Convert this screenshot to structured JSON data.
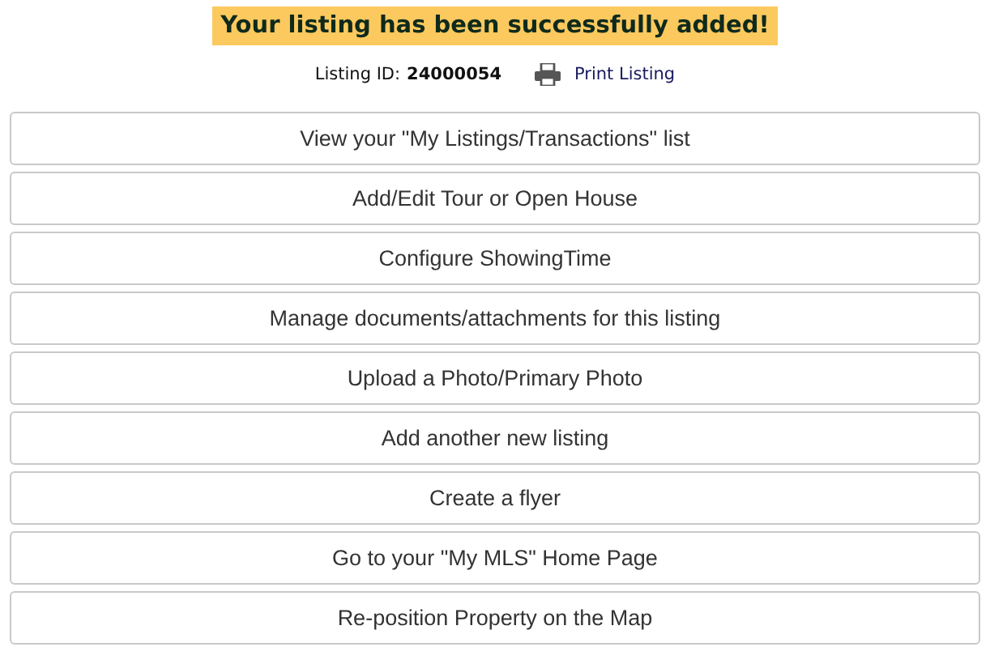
{
  "banner": "Your listing has been successfully added!",
  "listing_id": {
    "label": "Listing ID:",
    "value": "24000054"
  },
  "print_link": "Print Listing",
  "actions": [
    "View your \"My Listings/Transactions\" list",
    "Add/Edit Tour or Open House",
    "Configure ShowingTime",
    "Manage documents/attachments for this listing",
    "Upload a Photo/Primary Photo",
    "Add another new listing",
    "Create a flyer",
    "Go to your \"My MLS\" Home Page",
    "Re-position Property on the Map"
  ]
}
